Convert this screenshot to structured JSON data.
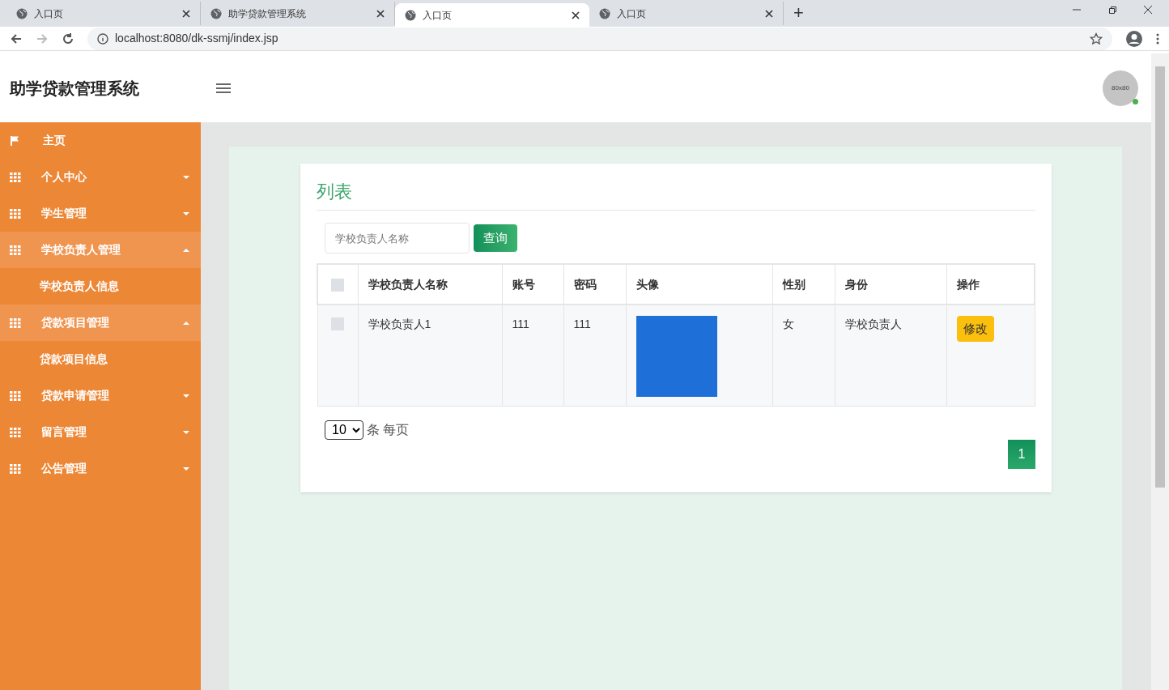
{
  "browser": {
    "tabs": [
      {
        "title": "入口页",
        "selected": false
      },
      {
        "title": "助学贷款管理系统",
        "selected": false
      },
      {
        "title": "入口页",
        "selected": true
      },
      {
        "title": "入口页",
        "selected": false
      }
    ],
    "new_tab": "+",
    "address": "localhost:8080/dk-ssmj/index.jsp"
  },
  "header": {
    "title": "助学贷款管理系统",
    "avatar": "80x80"
  },
  "sidebar": {
    "items": [
      {
        "label": "主页",
        "kind": "home",
        "expanded": false
      },
      {
        "label": "个人中心",
        "kind": "group",
        "expanded": false
      },
      {
        "label": "学生管理",
        "kind": "group",
        "expanded": false
      },
      {
        "label": "学校负责人管理",
        "kind": "group",
        "expanded": true,
        "children": [
          {
            "label": "学校负责人信息"
          }
        ]
      },
      {
        "label": "贷款项目管理",
        "kind": "group",
        "expanded": true,
        "children": [
          {
            "label": "贷款项目信息"
          }
        ]
      },
      {
        "label": "贷款申请管理",
        "kind": "group",
        "expanded": false
      },
      {
        "label": "留言管理",
        "kind": "group",
        "expanded": false
      },
      {
        "label": "公告管理",
        "kind": "group",
        "expanded": false
      }
    ]
  },
  "panel": {
    "title": "列表",
    "search": {
      "placeholder": "学校负责人名称",
      "button": "查询"
    },
    "table": {
      "select_all": false,
      "columns": [
        "学校负责人名称",
        "账号",
        "密码",
        "头像",
        "性别",
        "身份",
        "操作"
      ],
      "rows": [
        {
          "checked": false,
          "name": "学校负责人1",
          "account": "111",
          "password": "111",
          "gender": "女",
          "role": "学校负责人",
          "action": "修改"
        }
      ]
    },
    "page_size": "10",
    "page_size_label": "条 每页",
    "pages": [
      {
        "label": "1",
        "selected": true
      }
    ]
  }
}
